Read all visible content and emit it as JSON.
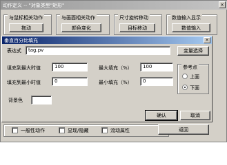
{
  "background_window": {
    "title": "动作定义 -- \"对象类型\"矩形\"",
    "close_glyph": "×",
    "groups": [
      {
        "caption": "与鼠标相关动作",
        "button": "拖动"
      },
      {
        "caption": "与画面相关动作",
        "button": "颜色变化"
      },
      {
        "caption": "尺寸旋转移动",
        "button": "目标移动"
      },
      {
        "caption": "数值输入显示",
        "button": "数值输入"
      }
    ],
    "bottom_checks": [
      "一般性动作",
      "显现/隐藏",
      "流动属性"
    ],
    "return_button": "返回"
  },
  "dialog": {
    "title": "垂直百分比填充",
    "close_glyph": "×",
    "expression_label": "表达式",
    "expression_value": "tag.pv",
    "var_select_button": "变量选择",
    "max_fill_value_label": "填充到最大时值",
    "max_fill_value": "100",
    "max_fill_pct_label": "最大填充（%）",
    "max_fill_pct": "100",
    "min_fill_value_label": "填充到最小时值",
    "min_fill_value": "0",
    "min_fill_pct_label": "最小填充（%）",
    "min_fill_pct": "0",
    "bg_color_label": "背景色",
    "bg_color": "#ffffff",
    "ref_point_caption": "参考点",
    "ref_top_label": "上面",
    "ref_bottom_label": "下面",
    "ref_selected": "下面",
    "ok_button": "确认",
    "cancel_button": "取消"
  }
}
